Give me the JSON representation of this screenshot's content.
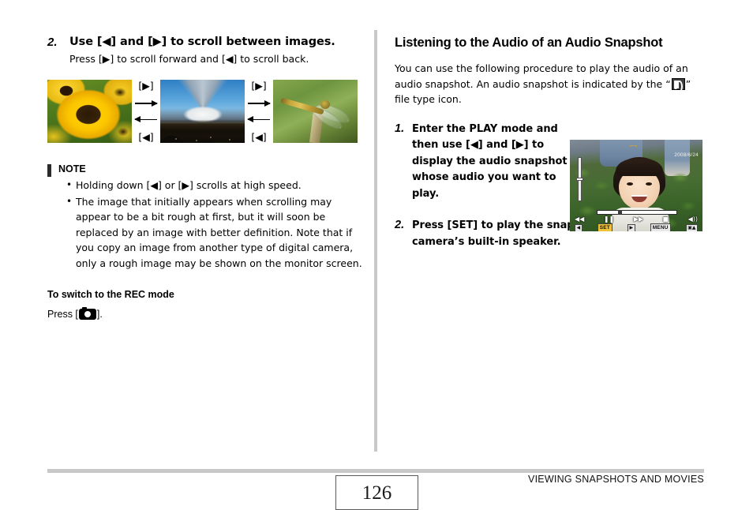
{
  "document": {
    "type": "camera-user-manual-page",
    "page_number": "126",
    "footer_section_title": "VIEWING SNAPSHOTS AND MOVIES"
  },
  "left_column": {
    "step": {
      "number": "2.",
      "title": "Use [◀] and [▶] to scroll between images.",
      "body": "Press [▶] to scroll forward and [◀] to scroll back."
    },
    "sequence": {
      "images": [
        {
          "name": "yellow-flowers-photo",
          "alt": "Yellow coneflowers close-up"
        },
        {
          "name": "mount-fuji-photo",
          "alt": "Mount Fuji with blue sky"
        },
        {
          "name": "dragonfly-photo",
          "alt": "Dragonfly perched on a twig"
        }
      ],
      "forward_label": "[▶]",
      "back_label": "[◀]"
    },
    "note": {
      "title": "NOTE",
      "items": [
        "Holding down [◀] or [▶] scrolls at high speed.",
        "The image that initially appears when scrolling may appear to be a bit rough at first, but it will soon be replaced by an image with better definition. Note that if you copy an image from another type of digital camera, only a rough image may be shown on the monitor screen."
      ]
    },
    "rec_mode": {
      "heading": "To switch to the REC mode",
      "press_prefix": "Press [",
      "press_suffix": "]."
    }
  },
  "right_column": {
    "section_title": "Listening to the Audio of an Audio Snapshot",
    "intro_part1": "You can use the following procedure to play the audio of an audio snapshot. An audio snapshot is indicated by the “",
    "intro_part2": "” file type icon.",
    "steps": [
      {
        "number": "1.",
        "text": "Enter the PLAY mode and then use [◀] and [▶] to display the audio snapshot whose audio you want to play."
      },
      {
        "number": "2.",
        "text": "Press [SET] to play the snapshot’s audio from the camera’s built-in speaker."
      }
    ],
    "lcd_screenshot": {
      "name": "camera-lcd-playback-screen",
      "alt": "Camera LCD showing a smiling child in a strawberry field during audio playback",
      "af_frame": "⌐¬",
      "date_text": "2008/6/24",
      "controls": {
        "rewind": "◀◀",
        "pause": "❚❚",
        "forward": "▶▶",
        "stop": "■",
        "volume": "◀))"
      },
      "buttons": {
        "left_key": "◀",
        "set_key": "SET",
        "right_key": "▶",
        "menu_key": "MENU",
        "zoom_key": "▣▲"
      }
    }
  },
  "colors": {
    "divider_gray": "#c8c8c8",
    "note_bar": "#2b2b2b",
    "page_box_border": "#5a5a5a",
    "text": "#000000"
  }
}
